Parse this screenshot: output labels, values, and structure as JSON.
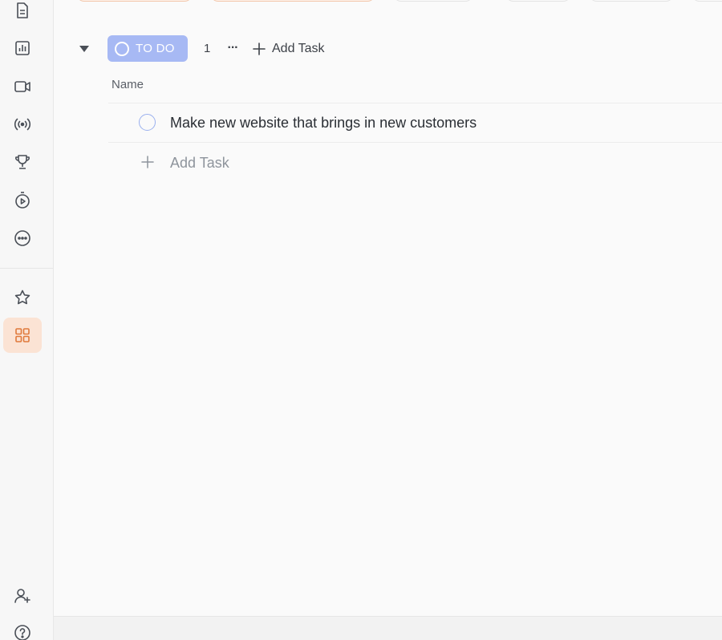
{
  "sidebar": {
    "icons": [
      "document-icon",
      "chart-icon",
      "video-icon",
      "broadcast-icon",
      "trophy-icon",
      "timer-icon",
      "more-icon",
      "star-icon",
      "apps-grid-icon",
      "add-user-icon",
      "help-icon"
    ],
    "active_item": "apps-grid-icon"
  },
  "group": {
    "status_label": "TO DO",
    "count": "1",
    "more_label": "···",
    "add_task_label": "Add Task"
  },
  "table": {
    "columns": [
      "Name"
    ],
    "tasks": [
      {
        "name": "Make new website that brings in new customers"
      }
    ],
    "add_task_label": "Add Task"
  },
  "colors": {
    "status_todo": "#a7b9f4",
    "accent_orange": "#e07a3c",
    "active_bg": "#fbe3d4"
  }
}
